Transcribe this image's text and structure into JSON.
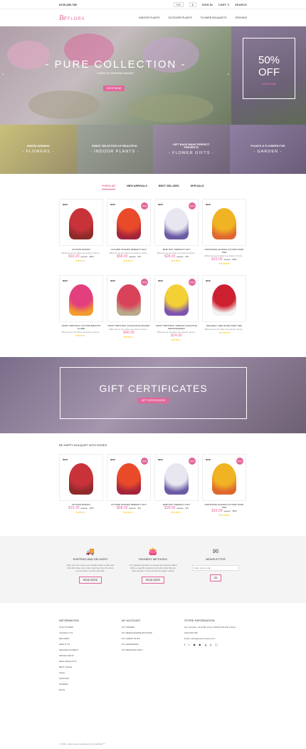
{
  "topbar": {
    "phone": "8725-456-789",
    "lang": "EN",
    "currency": "$",
    "signin": "SIGN IN",
    "cart": "CART: 0",
    "search": "SEARCH"
  },
  "logo": {
    "mark": "Be",
    "name": "FLORA"
  },
  "menu": [
    "INDOOR PLANTS",
    "OUTDOOR PLANTS",
    "FLOWER BOUQUETS",
    "ORCHIDS"
  ],
  "hero": {
    "title": "- PURE COLLECTION -",
    "subtitle": "LARGE FLOWERING BASKET",
    "button": "SHOP NOW!",
    "prev": "‹",
    "next": "›"
  },
  "sale": {
    "percent": "50%",
    "off": "OFF",
    "link": "SHOP NOW"
  },
  "categories": [
    {
      "top": "Award-winning",
      "name": "- Flowers -",
      "color": "#a5a07a"
    },
    {
      "top": "Great selection of beautiful",
      "name": "- Indoor Plants -",
      "color": "#8f928a"
    },
    {
      "top": "Gift bags make perfect presents",
      "name": "- Flower Gifts -",
      "color": "#877a8d"
    },
    {
      "top": "Plants & Flowers for",
      "name": "- Garden -",
      "color": "#7a6c86"
    }
  ],
  "tabs": [
    "POPULAR",
    "NEW ARRIVALS",
    "BEST SELLERS",
    "SPECIALS"
  ],
  "products1": [
    {
      "new": "NEW",
      "sale": "",
      "name": "AUTUMN BASKET",
      "desc": "What do we do when we want to show...",
      "price": "$19.20",
      "old": "$24.00",
      "disc": "-20%",
      "stars": "★★★★☆",
      "c1": "#c8333a",
      "c2": "#8e2a2a"
    },
    {
      "new": "NEW",
      "sale": "SALE",
      "name": "AUTUMN SHADES PERFECT GIFT",
      "desc": "What do we do when we want to show...",
      "price": "$58.00",
      "old": "$60.00",
      "disc": "-2%",
      "stars": "★★★★☆",
      "c1": "#e94b2a",
      "c2": "#a4243b"
    },
    {
      "new": "NEW",
      "sale": "SALE",
      "name": "BABY-BOY PERFECT GIFT",
      "desc": "What do we do when we want to show...",
      "price": "$28.00",
      "old": "$30.00",
      "disc": "-2%",
      "stars": "★★★★☆",
      "c1": "#e8e6f0",
      "c2": "#6b5aa5"
    },
    {
      "new": "NEW",
      "sale": "",
      "name": "FAIRTRADE GOLDEN AUTUMN HAND TIED",
      "desc": "What do we do when we want to show...",
      "price": "$15.00",
      "old": "$30.00",
      "disc": "-50%",
      "stars": "★★★★★",
      "c1": "#f0b323",
      "c2": "#e0672e"
    }
  ],
  "products2": [
    {
      "new": "NEW",
      "sale": "",
      "name": "HAPPY BIRTHDAY AUTUMN BRIGHTS GLOBE",
      "desc": "What do we do when we want to show...",
      "price": "",
      "old": "",
      "disc": "",
      "stars": "★★★★☆",
      "c1": "#e33f7f",
      "c2": "#f39b2c"
    },
    {
      "new": "NEW",
      "sale": "SALE",
      "name": "HAPPY BIRTHDAY KALANCHOE BASKET",
      "desc": "What do we do when we want to show...",
      "price": "$40.00",
      "old": "",
      "disc": "",
      "stars": "★★★★☆",
      "c1": "#d9435a",
      "c2": "#b9a98a"
    },
    {
      "new": "NEW",
      "sale": "SALE",
      "name": "HAPPY BIRTHDAY VIBRANT EXQUISITE ARRANGEMENT",
      "desc": "What do we do when we want to show...",
      "price": "$14.00",
      "old": "",
      "disc": "",
      "stars": "★★★★☆",
      "c1": "#f4d037",
      "c2": "#7d54b0"
    },
    {
      "new": "NEW",
      "sale": "",
      "name": "HEAVENLY RED ROSE HAND TIED",
      "desc": "What do we do when we want to show...",
      "price": "",
      "old": "",
      "disc": "",
      "stars": "★★★★★",
      "c1": "#cc1f2f",
      "c2": "#f3f3f3"
    }
  ],
  "gift": {
    "title": "GIFT CERTIFICATES",
    "button": "GIFT CERTIFICATES"
  },
  "section2": "BE HAPPY BOUQUET WITH ROSES",
  "products3": [
    {
      "new": "NEW",
      "sale": "",
      "name": "AUTUMN BASKET",
      "desc": "",
      "price": "$19.20",
      "old": "$24.00",
      "disc": "-20%",
      "stars": "★★★★☆",
      "c1": "#c8333a",
      "c2": "#8e2a2a"
    },
    {
      "new": "NEW",
      "sale": "SALE",
      "name": "AUTUMN SHADES PERFECT GIFT",
      "desc": "",
      "price": "$58.00",
      "old": "$60.00",
      "disc": "-2%",
      "stars": "★★★★☆",
      "c1": "#e94b2a",
      "c2": "#a4243b"
    },
    {
      "new": "NEW",
      "sale": "SALE",
      "name": "BABY-BOY PERFECT GIFT",
      "desc": "",
      "price": "$28.00",
      "old": "$30.00",
      "disc": "-2%",
      "stars": "★★★★☆",
      "c1": "#e8e6f0",
      "c2": "#6b5aa5"
    },
    {
      "new": "NEW",
      "sale": "SALE",
      "name": "FAIRTRADE GOLDEN AUTUMN HAND TIED",
      "desc": "",
      "price": "$15.00",
      "old": "$30.00",
      "disc": "-50%",
      "stars": "★★★★★",
      "c1": "#f0b323",
      "c2": "#e0672e"
    }
  ],
  "info": [
    {
      "icon": "🚚",
      "title": "SHIPPING AND DELIVERY",
      "text": "Here you can meet some details about a silky bow that will make your order's journey from the store to your place smooth and safe.",
      "button": "READ MORE"
    },
    {
      "icon": "👛",
      "title": "PAYMENT METHODS",
      "text": "It is equally important to choose the solution which offers a specific selection of credit cards that are most popular in the merchant's target market.",
      "button": "READ MORE"
    },
    {
      "icon": "✉",
      "title": "NEWSLETTER",
      "placeholder": "Enter your e-mail",
      "button": "OK"
    }
  ],
  "footer": {
    "information": {
      "title": "INFORMATION",
      "links": [
        "OUR STORES",
        "CONTACT US",
        "DELIVERY",
        "ABOUT US",
        "SECURE PAYMENT",
        "PRICES DROP",
        "NEW PRODUCTS",
        "BEST SALES",
        "FAQS",
        "SUPPORT",
        "SITEMAP",
        "BLOG"
      ]
    },
    "account": {
      "title": "MY ACCOUNT",
      "links": [
        "MY ORDERS",
        "MY MERCHANDISE RETURNS",
        "MY CREDIT SLIPS",
        "MY ADDRESSES",
        "MY PERSONAL INFO"
      ]
    },
    "store": {
      "title": "STORE INFORMATION",
      "address": "My Company, 42 Puffin street 12345 Puffinville France",
      "phone": "0123-456-789",
      "email": "Email: sales@yourcompany.com"
    },
    "copyright": "© 2016 - Ecommerce software by PrestaShop™"
  }
}
